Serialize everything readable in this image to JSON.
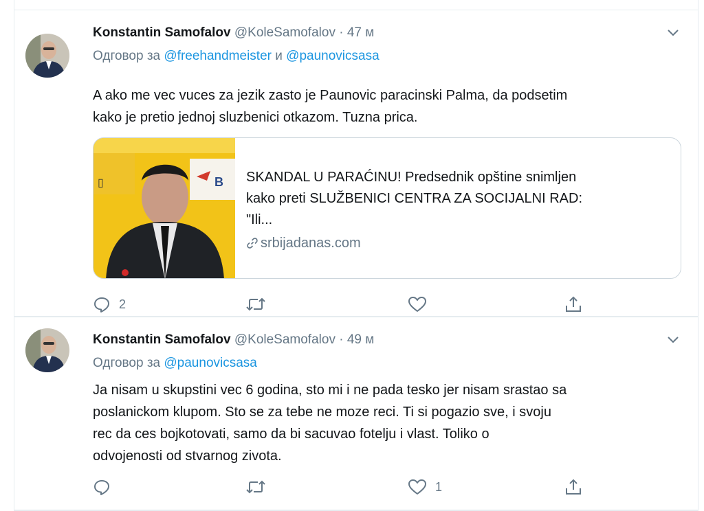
{
  "tweets": [
    {
      "author": "Konstantin Samofalov",
      "handle": "@KoleSamofalov",
      "separator": "·",
      "time": "47 м",
      "reply_prefix": "Одговор за",
      "reply_to": [
        "@freehandmeister",
        "@paunovicsasa"
      ],
      "reply_joiner": "и",
      "text_lines": [
        "A ako me vec vuces za jezik zasto je Paunovic paracinski Palma, da podsetim",
        "kako je pretio jednoj sluzbenici otkazom. Tuzna prica."
      ],
      "card": {
        "title_lines": [
          "SKANDAL U PARAĆINU! Predsednik opštine snimljen",
          "kako preti SLUŽBENICI CENTRA ZA SOCIJALNI RAD:",
          "\"Ili..."
        ],
        "domain": "srbijadanas.com"
      },
      "actions": {
        "replies": "2",
        "retweets": "",
        "likes": ""
      }
    },
    {
      "author": "Konstantin Samofalov",
      "handle": "@KoleSamofalov",
      "separator": "·",
      "time": "49 м",
      "reply_prefix": "Одговор за",
      "reply_to": [
        "@paunovicsasa"
      ],
      "text_lines": [
        "Ja nisam u skupstini vec 6 godina, sto mi i ne pada tesko jer nisam srastao sa",
        "poslanickom klupom. Sto se za tebe ne moze reci. Ti si pogazio sve, i svoju",
        "rec da ces bojkotovati, samo da bi sacuvao fotelju i vlast. Toliko o",
        "odvojenosti od stvarnog zivota."
      ],
      "actions": {
        "replies": "",
        "retweets": "",
        "likes": "1"
      }
    }
  ],
  "colors": {
    "accent": "#1b95e0",
    "muted": "#657786",
    "text": "#14171a",
    "border": "#e6ecf0"
  },
  "icons": [
    "reply-icon",
    "retweet-icon",
    "like-icon",
    "share-icon",
    "chevron-down-icon",
    "link-icon"
  ]
}
